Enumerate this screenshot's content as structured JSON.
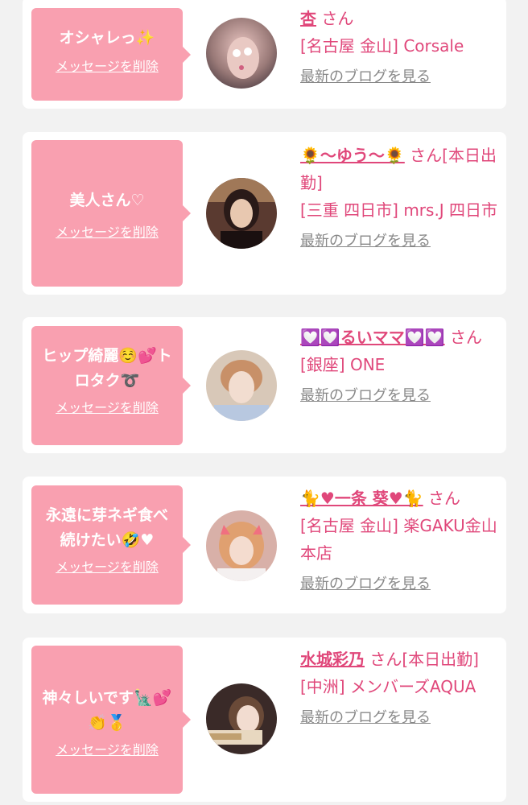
{
  "common": {
    "delete_label": "メッセージを削除",
    "blog_label": "最新のブログを見る",
    "san": "さん"
  },
  "colors": {
    "accent": "#e0477a",
    "bubble": "#f9a0b0",
    "link_gray": "#888888",
    "background": "#f2f2f2"
  },
  "items": [
    {
      "message": "オシャレっ✨",
      "name": "杏",
      "suffix": " さん",
      "location": "[名古屋 金山] Corsale"
    },
    {
      "message": "美人さん♡",
      "name": "🌻〜ゆう〜🌻",
      "suffix": " さん[本日出勤]",
      "location": "[三重 四日市] mrs.J 四日市"
    },
    {
      "message": "ヒップ綺麗☺️💕トロタク➰",
      "name": "💟💟るいママ💟💟",
      "suffix": " さん",
      "location": "[銀座] ONE"
    },
    {
      "message": "永遠に芽ネギ食べ続けたい🤣♥",
      "name": "🐈♥一条 葵♥🐈",
      "suffix": " さん",
      "location": "[名古屋 金山] 楽GAKU金山本店"
    },
    {
      "message": "神々しいです🗽💕👏🥇",
      "name": "水城彩乃",
      "suffix": " さん[本日出勤]",
      "location": "[中洲] メンバーズAQUA"
    }
  ]
}
